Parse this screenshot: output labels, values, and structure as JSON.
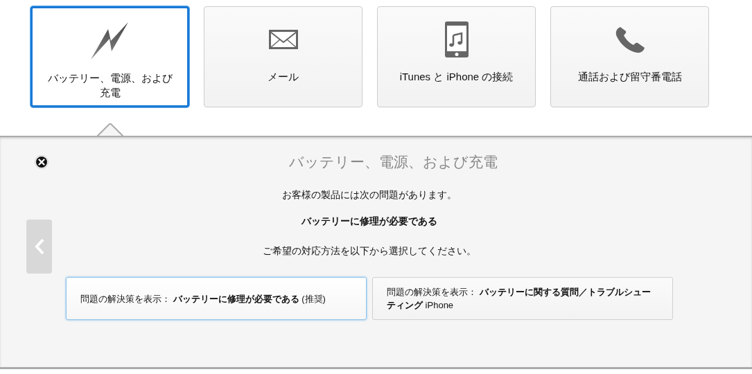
{
  "categories": [
    {
      "kind": "power",
      "label": "バッテリー、電源、および充電",
      "selected": true
    },
    {
      "kind": "mail",
      "label": "メール",
      "selected": false
    },
    {
      "kind": "sync",
      "label": "iTunes と iPhone の接続",
      "selected": false
    },
    {
      "kind": "call",
      "label": "通話および留守番電話",
      "selected": false
    }
  ],
  "panel": {
    "title": "バッテリー、電源、および充電",
    "intro": "お客様の製品には次の問題があります。",
    "issue": "バッテリーに修理が必要である",
    "prompt": "ご希望の対応方法を以下から選択してください。",
    "options": [
      {
        "text": "問題の解決策を表示： **バッテリーに修理が必要である** (推奨)",
        "selected": true
      },
      {
        "text": "問題の解決策を表示： **バッテリーに関する質問／トラブルシューティング** iPhone",
        "selected": false
      }
    ]
  }
}
